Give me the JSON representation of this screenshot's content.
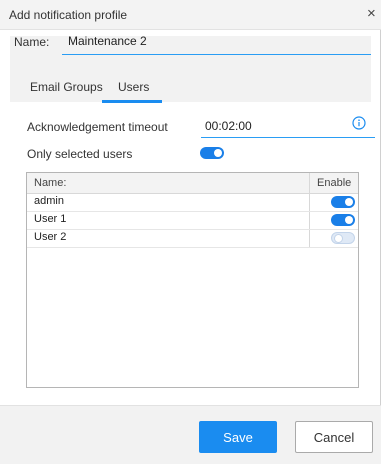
{
  "dialog": {
    "title": "Add notification profile",
    "close_glyph": "×"
  },
  "name_field": {
    "label": "Name:",
    "value": "Maintenance 2"
  },
  "tabs": [
    {
      "label": "Email Groups",
      "active": false
    },
    {
      "label": "Users",
      "active": true
    }
  ],
  "acknowledgement": {
    "label": "Acknowledgement timeout",
    "value": "00:02:00",
    "info_icon": "info-circle-icon"
  },
  "only_selected_users": {
    "label": "Only selected users",
    "enabled": true
  },
  "users_table": {
    "columns": [
      "Name:",
      "Enable"
    ],
    "rows": [
      {
        "name": "admin",
        "enabled": true
      },
      {
        "name": "User 1",
        "enabled": true
      },
      {
        "name": "User 2",
        "enabled": false
      }
    ]
  },
  "footer": {
    "save_label": "Save",
    "cancel_label": "Cancel"
  },
  "colors": {
    "accent": "#1a8cf0",
    "toggle_on": "#1a7fe8",
    "toggle_off": "#dfe9f6",
    "panel_bg": "#f2f2f2"
  }
}
